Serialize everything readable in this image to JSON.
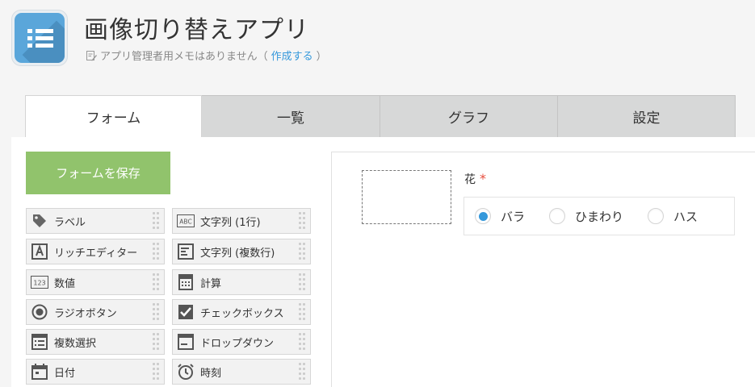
{
  "app": {
    "title": "画像切り替えアプリ",
    "memo_text": "アプリ管理者用メモはありません（",
    "memo_link": "作成する",
    "memo_close": "）"
  },
  "tabs": [
    {
      "label": "フォーム",
      "active": true
    },
    {
      "label": "一覧",
      "active": false
    },
    {
      "label": "グラフ",
      "active": false
    },
    {
      "label": "設定",
      "active": false
    }
  ],
  "save_button": "フォームを保存",
  "palette": {
    "left": [
      {
        "label": "ラベル",
        "icon": "tag-icon"
      },
      {
        "label": "リッチエディター",
        "icon": "rich-editor-icon"
      },
      {
        "label": "数値",
        "icon": "number-icon"
      },
      {
        "label": "ラジオボタン",
        "icon": "radio-icon"
      },
      {
        "label": "複数選択",
        "icon": "multi-select-icon"
      },
      {
        "label": "日付",
        "icon": "calendar-icon"
      }
    ],
    "right": [
      {
        "label": "文字列 (1行)",
        "icon": "text-single-icon"
      },
      {
        "label": "文字列 (複数行)",
        "icon": "text-multi-icon"
      },
      {
        "label": "計算",
        "icon": "calculator-icon"
      },
      {
        "label": "チェックボックス",
        "icon": "checkbox-icon"
      },
      {
        "label": "ドロップダウン",
        "icon": "dropdown-icon"
      },
      {
        "label": "時刻",
        "icon": "clock-icon"
      }
    ]
  },
  "form": {
    "field_label": "花",
    "required_mark": "*",
    "options": [
      {
        "label": "バラ",
        "selected": true
      },
      {
        "label": "ひまわり",
        "selected": false
      },
      {
        "label": "ハス",
        "selected": false
      }
    ]
  },
  "colors": {
    "save_button": "#91c36c",
    "accent": "#3498db",
    "required": "#e74c3c",
    "app_icon": "#5aa6da"
  }
}
